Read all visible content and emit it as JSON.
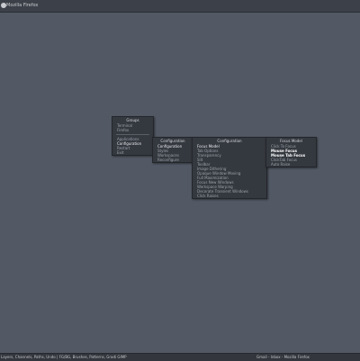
{
  "window": {
    "title": "Mozilla Firefox"
  },
  "menus": {
    "root": {
      "header": "Groups",
      "items_top": [
        "Terminal",
        "Firefox"
      ],
      "items_bottom": [
        "Applications",
        "Configuration",
        "Restart",
        "Exit"
      ]
    },
    "configuration": {
      "header": "Configuration",
      "items": [
        "Configuration",
        "Styles",
        "Workspaces",
        "Reconfigure"
      ]
    },
    "configuration_sub": {
      "header": "Configuration",
      "items": [
        "Focus Model",
        "Tab Options",
        "Transparency",
        "Slit",
        "Toolbar",
        "Image Dithering",
        "Opaque Window Moving",
        "Full Maximization",
        "Focus New Windows",
        "Workspace Warping",
        "Decorate Transient Windows",
        "Click Raises"
      ]
    },
    "focus_model": {
      "header": "Focus Model",
      "items": [
        "Click To Focus",
        "Mouse Focus",
        "Mouse Tab Focus",
        "ClickTab Focus",
        "Auto Raise"
      ]
    }
  },
  "taskbar": {
    "left_text": "Layers, Channels, Paths, Undo | FG/BG, Brushes, Patterns, Gradi    GIMP",
    "right_text": "Gmail - Inbox - Mozilla Firefox"
  }
}
